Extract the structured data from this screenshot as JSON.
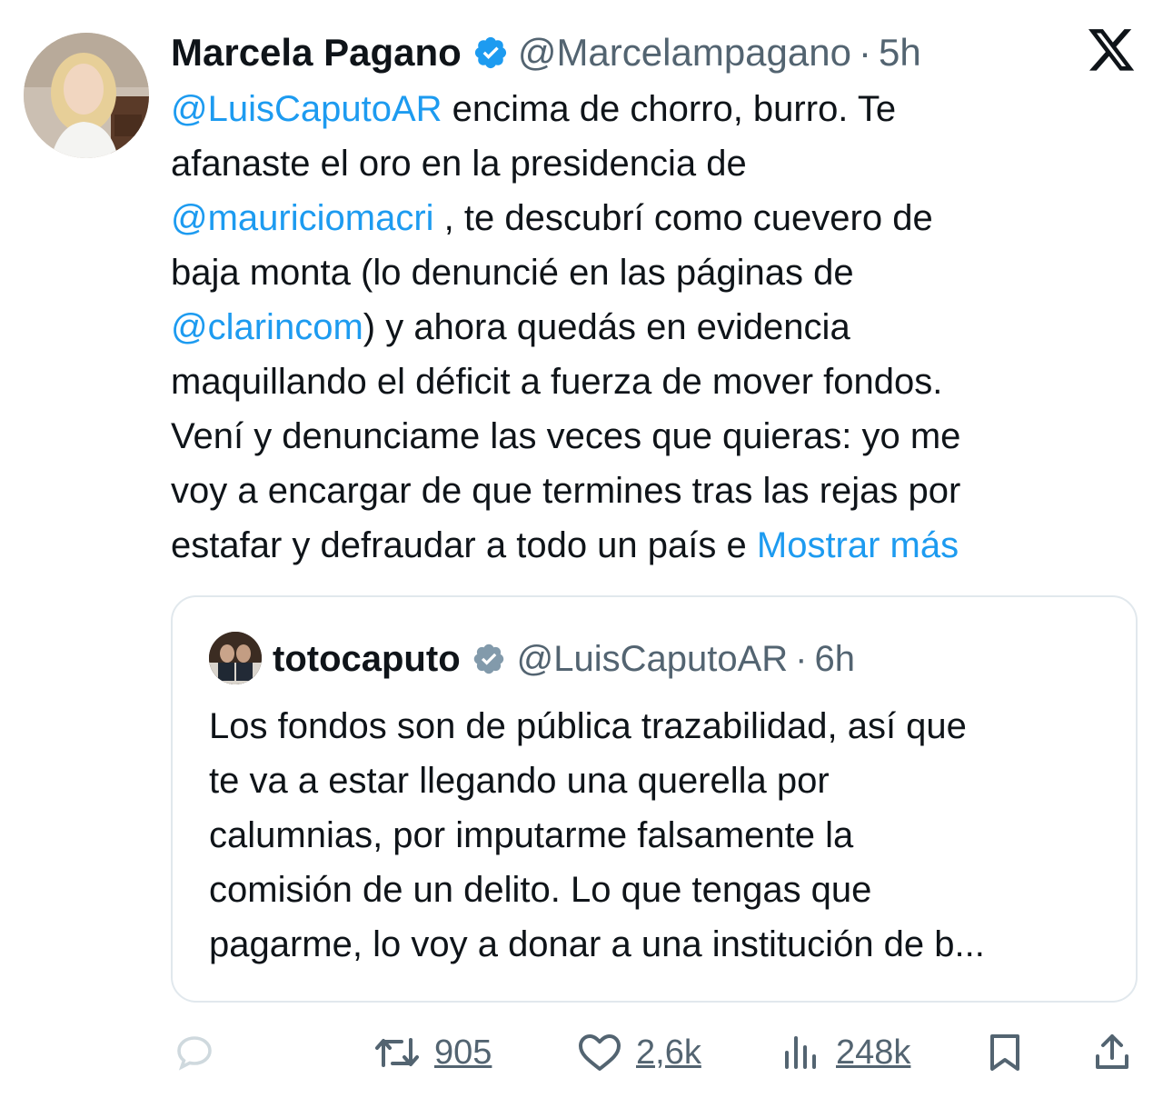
{
  "author": {
    "name": "Marcela Pagano",
    "handle": "@Marcelampagano",
    "separator": "·",
    "time": "5h"
  },
  "tweet": {
    "lines": [
      [
        {
          "t": "@LuisCaputoAR",
          "k": "mention"
        },
        {
          "t": " encima de chorro, burro. Te",
          "k": "text"
        }
      ],
      [
        {
          "t": "afanaste el oro en la presidencia de",
          "k": "text"
        }
      ],
      [
        {
          "t": "@mauriciomacri",
          "k": "mention"
        },
        {
          "t": " , te descubrí como cuevero de",
          "k": "text"
        }
      ],
      [
        {
          "t": "baja monta (lo denuncié en las páginas de",
          "k": "text"
        }
      ],
      [
        {
          "t": "@clarincom",
          "k": "mention"
        },
        {
          "t": ") y ahora quedás en evidencia",
          "k": "text"
        }
      ],
      [
        {
          "t": "maquillando el déficit a fuerza de mover fondos.",
          "k": "text"
        }
      ],
      [
        {
          "t": "Vení y denunciame las veces que quieras: yo me",
          "k": "text"
        }
      ],
      [
        {
          "t": "voy a encargar de que termines tras las rejas por",
          "k": "text"
        }
      ],
      [
        {
          "t": "estafar y defraudar a todo un país e ",
          "k": "text"
        },
        {
          "t": "Mostrar más",
          "k": "more"
        }
      ]
    ]
  },
  "quoted": {
    "name": "totocaputo",
    "handle": "@LuisCaputoAR",
    "separator": "·",
    "time": "6h",
    "lines": [
      "Los fondos son de pública trazabilidad, así que",
      "te va a estar llegando una querella por",
      "calumnias, por imputarme falsamente la",
      "comisión de un delito. Lo que tengas que",
      "pagarme, lo voy a donar a una institución de b..."
    ]
  },
  "actions": {
    "retweets": "905",
    "likes": "2,6k",
    "views": "248k"
  },
  "colors": {
    "link": "#1d9bf0",
    "muted": "#536471",
    "text": "#0f1419",
    "verified_badge": "#1d9bf0",
    "quoted_verified_badge": "#829aab"
  },
  "icons": [
    "verified-badge-icon",
    "x-logo-icon",
    "reply-icon",
    "retweet-icon",
    "like-icon",
    "views-icon",
    "bookmark-icon",
    "share-icon"
  ]
}
